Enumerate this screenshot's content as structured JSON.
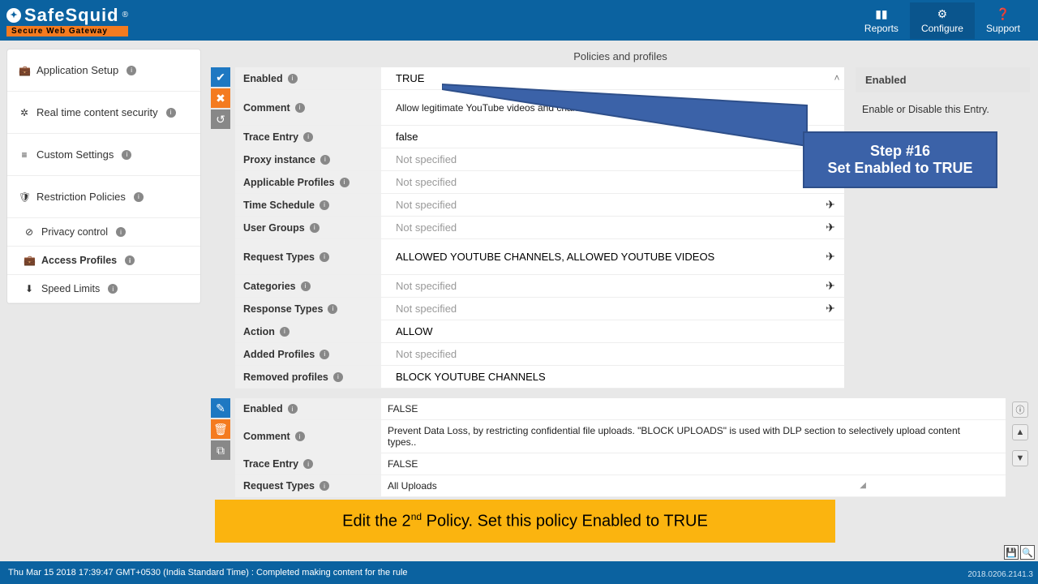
{
  "brand": {
    "name": "SafeSquid",
    "reg": "®",
    "tagline": "Secure Web Gateway"
  },
  "topnav": {
    "reports": "Reports",
    "configure": "Configure",
    "support": "Support"
  },
  "sidebar": {
    "app_setup": "Application Setup",
    "realtime": "Real time content security",
    "custom": "Custom Settings",
    "restriction": "Restriction Policies",
    "privacy": "Privacy control",
    "access": "Access Profiles",
    "speed": "Speed Limits"
  },
  "page_title": "Policies and profiles",
  "help": {
    "title": "Enabled",
    "body": "Enable or Disable this Entry."
  },
  "policy1": {
    "enabled": {
      "label": "Enabled",
      "value": "TRUE"
    },
    "comment": {
      "label": "Comment",
      "value": "Allow legitimate YouTube videos and channels for all users."
    },
    "trace": {
      "label": "Trace Entry",
      "value": "false"
    },
    "proxy": {
      "label": "Proxy instance",
      "value": "Not specified"
    },
    "profiles": {
      "label": "Applicable Profiles",
      "value": "Not specified"
    },
    "schedule": {
      "label": "Time Schedule",
      "value": "Not specified"
    },
    "groups": {
      "label": "User Groups",
      "value": "Not specified"
    },
    "reqtypes": {
      "label": "Request Types",
      "value": "ALLOWED YOUTUBE CHANNELS,   ALLOWED YOUTUBE VIDEOS"
    },
    "categories": {
      "label": "Categories",
      "value": "Not specified"
    },
    "resptypes": {
      "label": "Response Types",
      "value": "Not specified"
    },
    "action": {
      "label": "Action",
      "value": "ALLOW"
    },
    "added": {
      "label": "Added Profiles",
      "value": "Not specified"
    },
    "removed": {
      "label": "Removed profiles",
      "value": "BLOCK YOUTUBE CHANNELS"
    }
  },
  "policy2": {
    "enabled": {
      "label": "Enabled",
      "value": "FALSE"
    },
    "comment": {
      "label": "Comment",
      "value": "Prevent Data Loss, by restricting confidential file uploads. \"BLOCK UPLOADS\" is used with DLP section to selectively  upload content types.."
    },
    "trace": {
      "label": "Trace Entry",
      "value": "FALSE"
    },
    "reqtypes": {
      "label": "Request Types",
      "value": "All Uploads"
    }
  },
  "callout": {
    "line1": "Step #16",
    "line2": "Set Enabled to TRUE"
  },
  "banner": {
    "pre": "Edit the 2",
    "sup": "nd",
    "post": " Policy. Set this policy Enabled to TRUE"
  },
  "footer": {
    "status": "Thu Mar 15 2018 17:39:47 GMT+0530 (India Standard Time) : Completed making content for the rule",
    "version": "2018.0206.2141.3"
  }
}
